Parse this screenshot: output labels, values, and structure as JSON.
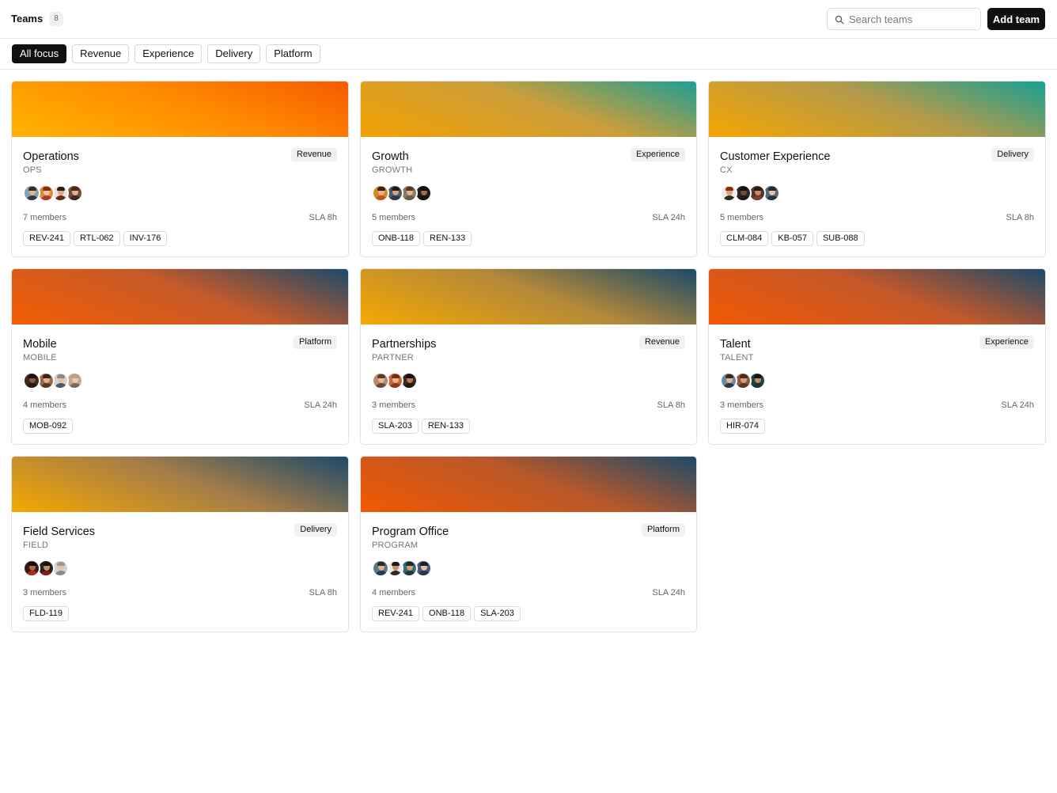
{
  "header": {
    "title": "Teams",
    "count": "8",
    "search_placeholder": "Search teams",
    "add_label": "Add team"
  },
  "filters": [
    {
      "label": "All focus",
      "active": true
    },
    {
      "label": "Revenue",
      "active": false
    },
    {
      "label": "Experience",
      "active": false
    },
    {
      "label": "Delivery",
      "active": false
    },
    {
      "label": "Platform",
      "active": false
    }
  ],
  "teams": [
    {
      "name": "Operations",
      "code": "OPS",
      "focus": "Revenue",
      "members": "7 members",
      "sla": "SLA 8h",
      "tickets": [
        "REV-241",
        "RTL-062",
        "INV-176"
      ],
      "gradient": [
        "#ffb400",
        "#ff8a00",
        "#f55a00"
      ],
      "avatars": [
        {
          "bg": "#7fa3b8",
          "skin": "#e2b48f",
          "hair": "#3a2b22",
          "shirt": "#2f3b4a"
        },
        {
          "bg": "#d98e3a",
          "skin": "#f0c29d",
          "hair": "#8c2a12",
          "shirt": "#b23a2a"
        },
        {
          "bg": "#e9e4dc",
          "skin": "#d9a884",
          "hair": "#2a1c16",
          "shirt": "#6a2a22"
        },
        {
          "bg": "#7a4a36",
          "skin": "#e6b18c",
          "hair": "#4a2a1a",
          "shirt": "#3a2a22"
        }
      ]
    },
    {
      "name": "Growth",
      "code": "GROWTH",
      "focus": "Experience",
      "members": "5 members",
      "sla": "SLA 24h",
      "tickets": [
        "ONB-118",
        "REN-133"
      ],
      "gradient": [
        "#f2a100",
        "#cc9e3a",
        "#1c9e96"
      ],
      "avatars": [
        {
          "bg": "#d48a2a",
          "skin": "#e6b08a",
          "hair": "#3a1e14",
          "shirt": "#c4541e"
        },
        {
          "bg": "#4a5a66",
          "skin": "#d9a27c",
          "hair": "#1a1a1a",
          "shirt": "#2a3a4a"
        },
        {
          "bg": "#8a7a6a",
          "skin": "#e2b08a",
          "hair": "#5a3a22",
          "shirt": "#6a5a4a"
        },
        {
          "bg": "#1e1e1e",
          "skin": "#a86a4a",
          "hair": "#0e0e0e",
          "shirt": "#141414"
        }
      ]
    },
    {
      "name": "Customer Experience",
      "code": "CX",
      "focus": "Delivery",
      "members": "5 members",
      "sla": "SLA 8h",
      "tickets": [
        "CLM-084",
        "KB-057",
        "SUB-088"
      ],
      "gradient": [
        "#f5a500",
        "#b49a4a",
        "#16a094"
      ],
      "avatars": [
        {
          "bg": "#efe9e2",
          "skin": "#d9a27c",
          "hair": "#8c2a12",
          "shirt": "#2a2a2a"
        },
        {
          "bg": "#2a2a2a",
          "skin": "#7a4a32",
          "hair": "#111111",
          "shirt": "#1a1a1a"
        },
        {
          "bg": "#4a3a32",
          "skin": "#c98a6a",
          "hair": "#2a1a12",
          "shirt": "#8a3a2a"
        },
        {
          "bg": "#5a6a7a",
          "skin": "#e6c0a0",
          "hair": "#1e2a3a",
          "shirt": "#223344"
        }
      ]
    },
    {
      "name": "Mobile",
      "code": "MOBILE",
      "focus": "Platform",
      "members": "4 members",
      "sla": "SLA 24h",
      "tickets": [
        "MOB-092"
      ],
      "gradient": [
        "#f25c00",
        "#c65a2a",
        "#1c4a6a"
      ],
      "avatars": [
        {
          "bg": "#3a2a22",
          "skin": "#8a5a3e",
          "hair": "#1a0e0a",
          "shirt": "#2a1a14"
        },
        {
          "bg": "#9a6a4a",
          "skin": "#e2b08a",
          "hair": "#3a2418",
          "shirt": "#5a3a2a"
        },
        {
          "bg": "#d6d2cc",
          "skin": "#e6c0a0",
          "hair": "#8a8a8a",
          "shirt": "#4a5a6a"
        },
        {
          "bg": "#c8a888",
          "skin": "#f0caa8",
          "hair": "#b8a080",
          "shirt": "#7a6a5a"
        }
      ]
    },
    {
      "name": "Partnerships",
      "code": "PARTNER",
      "focus": "Revenue",
      "members": "3 members",
      "sla": "SLA 8h",
      "tickets": [
        "SLA-203",
        "REN-133"
      ],
      "gradient": [
        "#f5a800",
        "#b2883a",
        "#1a4a6a"
      ],
      "avatars": [
        {
          "bg": "#b88a6a",
          "skin": "#e8b896",
          "hair": "#5a3a26",
          "shirt": "#6a4a3a"
        },
        {
          "bg": "#c46a3a",
          "skin": "#eab48e",
          "hair": "#7a2a14",
          "shirt": "#8a3a22"
        },
        {
          "bg": "#3a2a22",
          "skin": "#b87a5a",
          "hair": "#1a100c",
          "shirt": "#241812"
        }
      ]
    },
    {
      "name": "Talent",
      "code": "TALENT",
      "focus": "Experience",
      "members": "3 members",
      "sla": "SLA 24h",
      "tickets": [
        "HIR-074"
      ],
      "gradient": [
        "#f25800",
        "#c4582a",
        "#1c4a6a"
      ],
      "avatars": [
        {
          "bg": "#6a8aa0",
          "skin": "#e6b896",
          "hair": "#3a2a22",
          "shirt": "#2a3a4a"
        },
        {
          "bg": "#8a5a4a",
          "skin": "#d9a07c",
          "hair": "#4a2a1a",
          "shirt": "#5a3a2a"
        },
        {
          "bg": "#1a4a3a",
          "skin": "#c48a64",
          "hair": "#1a120e",
          "shirt": "#16382e"
        }
      ]
    },
    {
      "name": "Field Services",
      "code": "FIELD",
      "focus": "Delivery",
      "members": "3 members",
      "sla": "SLA 8h",
      "tickets": [
        "FLD-119"
      ],
      "gradient": [
        "#f5a800",
        "#a27c4a",
        "#1c4a6a"
      ],
      "avatars": [
        {
          "bg": "#3a1a14",
          "skin": "#a86a4a",
          "hair": "#140a08",
          "shirt": "#b02a1a"
        },
        {
          "bg": "#2a2222",
          "skin": "#c4906c",
          "hair": "#1a1010",
          "shirt": "#8a1a14"
        },
        {
          "bg": "#d8d2cc",
          "skin": "#e6c4a4",
          "hair": "#9a9a9a",
          "shirt": "#8a8a8a"
        }
      ]
    },
    {
      "name": "Program Office",
      "code": "PROGRAM",
      "focus": "Platform",
      "members": "4 members",
      "sla": "SLA 24h",
      "tickets": [
        "REV-241",
        "ONB-118",
        "SLA-203"
      ],
      "gradient": [
        "#f25800",
        "#b8582a",
        "#1c4a6a"
      ],
      "avatars": [
        {
          "bg": "#5a7a8a",
          "skin": "#e2b08a",
          "hair": "#2a2a2a",
          "shirt": "#2a3a4a"
        },
        {
          "bg": "#eee8e2",
          "skin": "#c8906a",
          "hair": "#1a1a1a",
          "shirt": "#2a2a2a"
        },
        {
          "bg": "#3a6a7a",
          "skin": "#d6a07c",
          "hair": "#1a2a2a",
          "shirt": "#1e3a4a"
        },
        {
          "bg": "#4a5a7a",
          "skin": "#e6c0a0",
          "hair": "#1a1a2a",
          "shirt": "#2a3450"
        }
      ]
    }
  ]
}
